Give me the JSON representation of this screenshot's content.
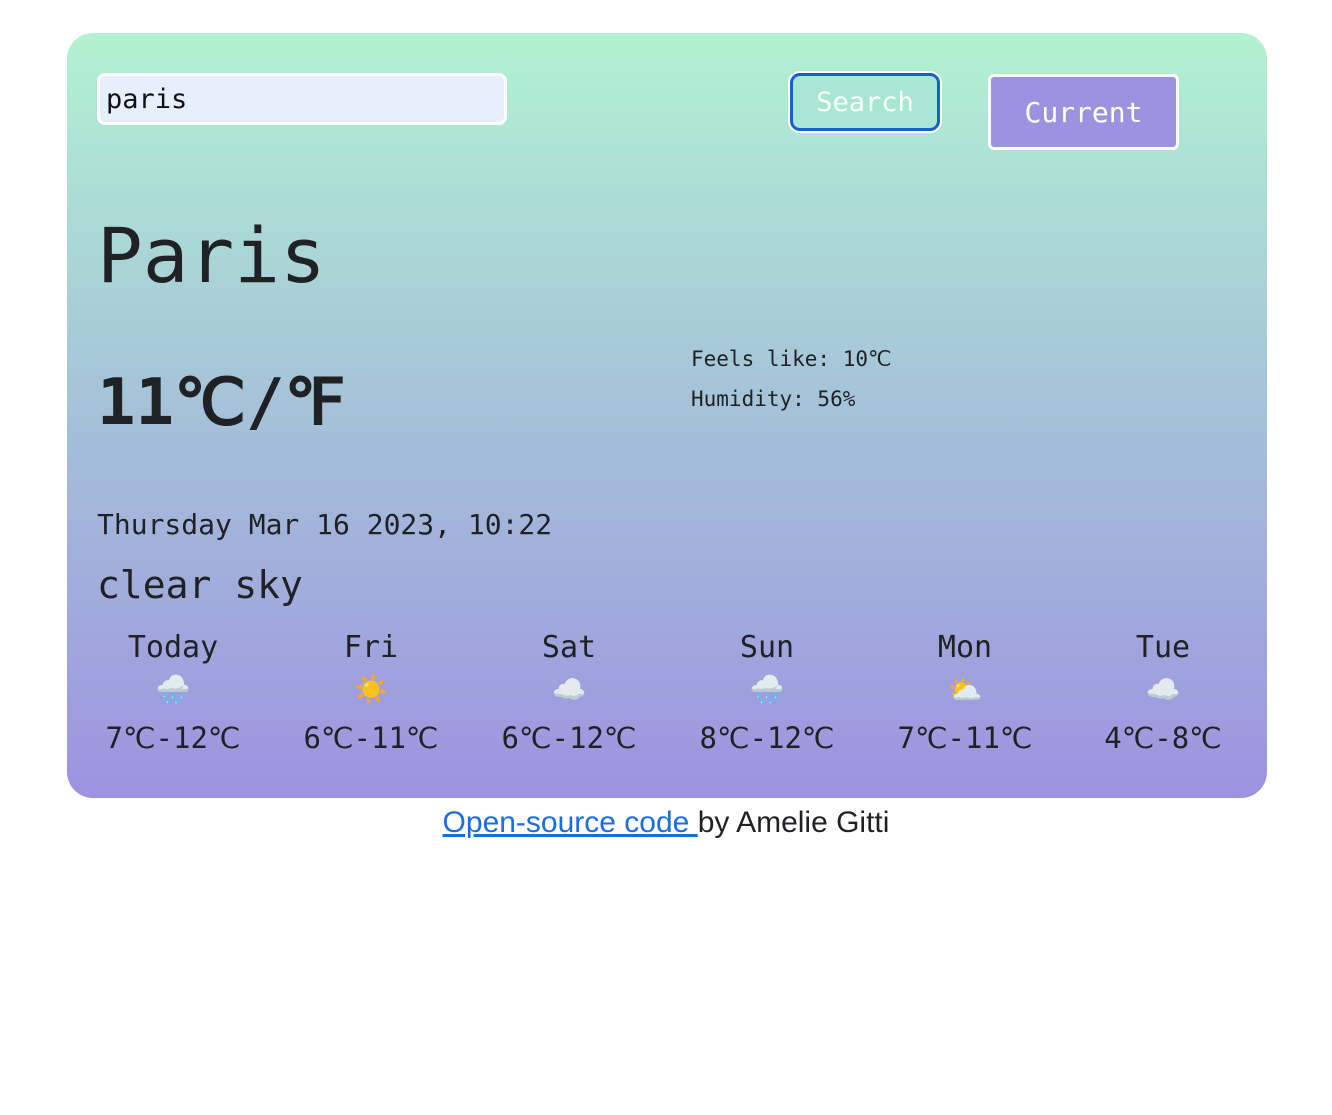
{
  "search": {
    "value": "paris",
    "button_label": "Search",
    "current_label": "Current"
  },
  "weather": {
    "city": "Paris",
    "temperature": "11",
    "unit_c": "℃",
    "unit_sep": "/",
    "unit_f": "℉",
    "feels_like": "Feels like: 10℃",
    "humidity": "Humidity: 56%",
    "datetime": "Thursday Mar 16 2023, 10:22",
    "description": "clear sky"
  },
  "forecast": [
    {
      "day": "Today",
      "icon": "🌧️",
      "icon_name": "rain-cloud-icon",
      "range": "7℃-12℃"
    },
    {
      "day": "Fri",
      "icon": "☀️",
      "icon_name": "sun-icon",
      "range": "6℃-11℃"
    },
    {
      "day": "Sat",
      "icon": "☁️",
      "icon_name": "cloud-icon",
      "range": "6℃-12℃"
    },
    {
      "day": "Sun",
      "icon": "🌧️",
      "icon_name": "rain-cloud-icon",
      "range": "8℃-12℃"
    },
    {
      "day": "Mon",
      "icon": "⛅",
      "icon_name": "sun-behind-cloud-icon",
      "range": "7℃-11℃"
    },
    {
      "day": "Tue",
      "icon": "☁️",
      "icon_name": "cloud-icon",
      "range": "4℃-8℃"
    }
  ],
  "footer": {
    "link_text": "Open-source code ",
    "suffix": "by Amelie Gitti"
  },
  "colors": {
    "gradient_top": "#b2f2d2",
    "gradient_bottom": "#9c93e0",
    "search_border": "#1761c9",
    "link": "#1a6ee0"
  }
}
